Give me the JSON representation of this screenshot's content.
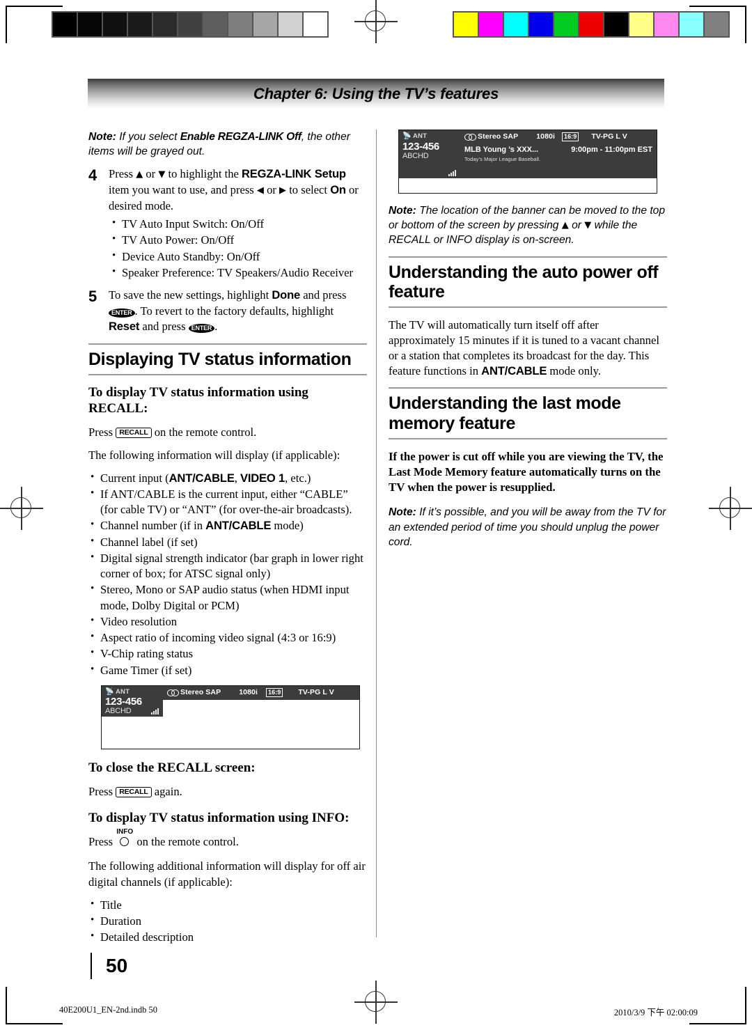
{
  "header": {
    "chapter_title": "Chapter 6: Using the TV’s features"
  },
  "page": {
    "number": "50"
  },
  "footer": {
    "left": "40E200U1_EN-2nd.indb   50",
    "right": "2010/3/9   下午 02:00:09"
  },
  "print_marks": {
    "gray_scale": [
      "#000000",
      "#060606",
      "#101010",
      "#1b1b1b",
      "#2c2c2c",
      "#414141",
      "#5e5e5e",
      "#7e7e7e",
      "#a6a6a6",
      "#d2d2d2",
      "#ffffff"
    ],
    "color_bars": [
      "#ffff00",
      "#ff00ff",
      "#00ffff",
      "#0000ee",
      "#00cc22",
      "#ee0000",
      "#000000",
      "#ffff88",
      "#ff88ee",
      "#88ffff",
      "#808080"
    ]
  },
  "left_column": {
    "note_top": {
      "label": "Note:",
      "text_before": " If you select ",
      "bold": "Enable REGZA-LINK Off",
      "text_after": ", the other items will be grayed out."
    },
    "step4": {
      "number": "4",
      "part1": "Press ",
      "up_arrow": "▲",
      "part2": " or ",
      "down_arrow": "▼",
      "part3": " to highlight the ",
      "bold1": "REGZA-LINK Setup",
      "part4": " item you want to use, and press ",
      "left_arrow": "◀",
      "part5": " or ",
      "right_arrow": "▶",
      "part6": " to select ",
      "bold2": "On",
      "part7": " or desired mode.",
      "bullets": [
        "TV Auto Input Switch: On/Off",
        "TV Auto Power: On/Off",
        "Device Auto Standby: On/Off",
        "Speaker Preference: TV Speakers/Audio Receiver"
      ]
    },
    "step5": {
      "number": "5",
      "part1": "To save the new settings, highlight ",
      "bold1": "Done",
      "part2": " and press ",
      "enter_key": "ENTER",
      "part3": ". To revert to the factory defaults, highlight ",
      "bold2": "Reset",
      "part4": " and press ",
      "enter_key2": "ENTER",
      "part5": "."
    },
    "section_displaying": "Displaying TV status information",
    "sub_recall": "To display TV status information using RECALL:",
    "press_recall_before": "Press ",
    "recall_key": "RECALL",
    "press_recall_after": " on the remote control.",
    "following_info": "The following information will display (if applicable):",
    "info_bullets": [
      {
        "pre": "Current input (",
        "b1": "ANT/CABLE",
        "mid": ", ",
        "b2": "VIDEO 1",
        "post": ", etc.)"
      },
      {
        "pre": "If ANT/CABLE is the current input, either “CABLE” (for cable TV) or “ANT” (for over-the-air broadcasts)."
      },
      {
        "pre": "Channel number (if in ",
        "b1": "ANT/CABLE",
        "post": " mode)"
      },
      {
        "pre": "Channel label (if set)"
      },
      {
        "pre": "Digital signal strength indicator (bar graph in lower right corner of box; for ATSC signal only)"
      },
      {
        "pre": "Stereo, Mono or SAP audio status (when HDMI input mode, Dolby Digital or PCM)"
      },
      {
        "pre": "Video resolution"
      },
      {
        "pre": "Aspect ratio of incoming video signal (4:3 or 16:9)"
      },
      {
        "pre": "V-Chip rating status"
      },
      {
        "pre": "Game Timer (if set)"
      }
    ],
    "sub_close_recall": "To close the RECALL screen:",
    "press_again_before": "Press ",
    "press_again_after": " again.",
    "sub_info": "To display TV status information using INFO:",
    "press_info_before": "Press ",
    "info_key": "INFO",
    "press_info_after": " on the remote control.",
    "additional_info": "The following additional information will display for off air digital channels (if applicable):",
    "info_items": [
      "Title",
      "Duration",
      "Detailed description"
    ]
  },
  "right_column": {
    "note_banner": {
      "label": "Note:",
      "p1": " The location of the banner can be moved to the top or bottom of the screen by pressing ",
      "up_arrow": "▲",
      "p2": " or ",
      "down_arrow": "▼",
      "p3": " while the RECALL or INFO display is on-screen."
    },
    "section_autopower": "Understanding the auto power off feature",
    "autopower_body": {
      "pre": "The TV will automatically turn itself off after approximately 15 minutes if it is tuned to a vacant channel or a station that completes its broadcast for the day. This feature functions in ",
      "bold": "ANT/CABLE",
      "post": " mode only."
    },
    "section_lastmode": "Understanding the last mode memory feature",
    "lastmode_bold": "If the power is cut off while you are viewing the TV, the Last Mode Memory feature automatically turns on the TV when the power is resupplied.",
    "note_unplug": {
      "label": "Note:",
      "text": " If it’s possible, and you will be away from the TV for an extended period of time you should unplug the power cord."
    }
  },
  "tv_banner_full": {
    "input_label": "ANT",
    "channel": "123-456",
    "channel_label": "ABCHD",
    "audio": "Stereo SAP",
    "resolution": "1080i",
    "aspect": "16:9",
    "rating": "TV-PG  L  V",
    "program_title": "MLB Young ’s XXX...",
    "program_time": "9:00pm - 11:00pm EST",
    "program_desc": "Today’s Major League Baseball.",
    "icons": {
      "antenna": "antenna-icon",
      "signal": "signal-strength-icon",
      "stereo": "stereo-icon"
    }
  },
  "tv_banner_recall": {
    "input_label": "ANT",
    "channel": "123-456",
    "channel_label": "ABCHD",
    "audio": "Stereo SAP",
    "resolution": "1080i",
    "aspect": "16:9",
    "rating": "TV-PG  L  V"
  }
}
